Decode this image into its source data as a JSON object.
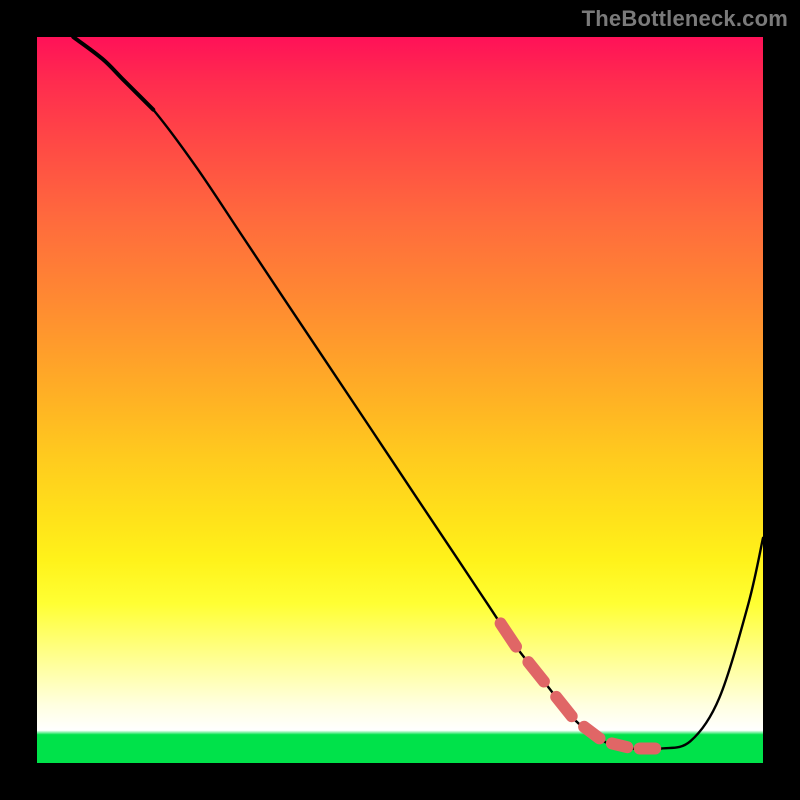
{
  "watermark": "TheBottleneck.com",
  "colors": {
    "background": "#000000",
    "gradient_top": "#ff1158",
    "gradient_mid": "#ffe11a",
    "gradient_bottom": "#00e24a",
    "curve": "#000000",
    "marker": "#e06666"
  },
  "chart_data": {
    "type": "line",
    "title": "",
    "xlabel": "",
    "ylabel": "",
    "xlim": [
      0,
      100
    ],
    "ylim": [
      0,
      100
    ],
    "series": [
      {
        "name": "bottleneck-curve",
        "x": [
          5,
          9,
          12,
          16,
          22,
          28,
          34,
          40,
          46,
          52,
          58,
          62,
          66,
          70,
          74,
          78,
          82,
          86,
          90,
          94,
          98,
          100
        ],
        "y": [
          100,
          97,
          94,
          90,
          82,
          73,
          64,
          55,
          46,
          37,
          28,
          22,
          16,
          11,
          6,
          3,
          2,
          2,
          3,
          9,
          22,
          31
        ]
      }
    ],
    "annotations": [
      {
        "name": "optimal-range-marker",
        "type": "segment-dashed",
        "x": [
          63,
          86
        ],
        "y": [
          3.5,
          3.5
        ],
        "color": "#e06666"
      }
    ]
  }
}
